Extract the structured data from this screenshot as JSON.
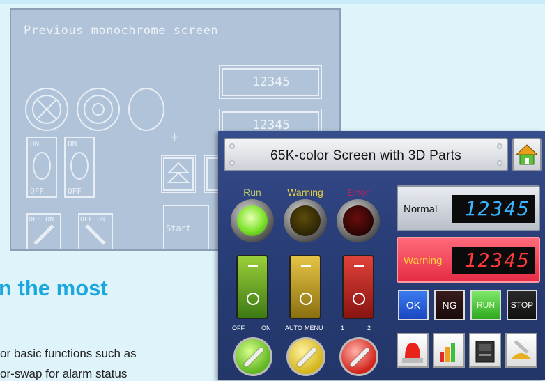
{
  "mono_panel": {
    "title": "Previous monochrome screen",
    "display_1": "12345",
    "display_2": "12345",
    "switch_1": {
      "top": "ON",
      "bottom": "OFF"
    },
    "switch_2": {
      "top": "ON",
      "bottom": "OFF"
    },
    "selector_1": "OFF ON",
    "selector_2": "OFF ON",
    "start_label": "Start"
  },
  "background_text": {
    "heading": "n the most",
    "line_1": "or basic functions such as",
    "line_2": "or-swap for alarm status"
  },
  "color_panel": {
    "title": "65K-color Screen with 3D Parts",
    "lamps": [
      {
        "label": "Run",
        "label_color": "#b8c76a"
      },
      {
        "label": "Warning",
        "label_color": "#e6d23a"
      },
      {
        "label": "Error",
        "label_color": "#c0205a"
      }
    ],
    "switch_labels": {
      "green": [
        "OFF",
        "ON"
      ],
      "yellow": [
        "AUTO",
        "MENU"
      ],
      "red": [
        "1",
        "2"
      ]
    },
    "displays": [
      {
        "label": "Normal",
        "value": "12345",
        "digit_color": "#3ab5ff"
      },
      {
        "label": "Warning",
        "value": "12345",
        "digit_color": "#ff3a3a"
      }
    ],
    "buttons": [
      "OK",
      "NG",
      "RUN",
      "STOP"
    ],
    "icon_buttons": [
      "alarm-light-icon",
      "bar-chart-icon",
      "controller-icon",
      "wrench-icon"
    ],
    "colors": {
      "panel": "#2e437f",
      "accent": "#1aa7dd"
    }
  }
}
